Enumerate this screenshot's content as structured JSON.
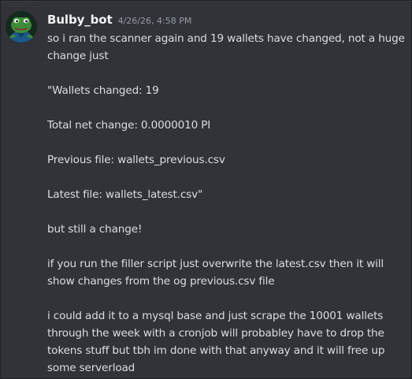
{
  "message": {
    "author": "Bulby_bot",
    "timestamp": "4/26/26, 4:58 PM",
    "lines": [
      "so i ran the scanner again and 19 wallets have changed, not a huge",
      "change just",
      "",
      "\"Wallets changed: 19",
      "",
      "Total net change: 0.0000010 PI",
      "",
      "Previous file: wallets_previous.csv",
      "",
      "Latest file: wallets_latest.csv\"",
      "",
      "but still a change!",
      "",
      "if you run the filler script just overwrite the latest.csv then it will",
      "show changes from the og previous.csv file",
      "",
      "i could add it to a mysql base and just scrape the 10001 wallets",
      "through the week with a cronjob will probabley have to drop the",
      "tokens stuff but tbh im done with that anyway and it will free up",
      "some serverload"
    ]
  },
  "colors": {
    "background": "#313338",
    "text": "#dbdee1",
    "username": "#f2f3f5",
    "timestamp": "#949ba4"
  },
  "icons": {
    "avatar": "frog-avatar-icon"
  }
}
